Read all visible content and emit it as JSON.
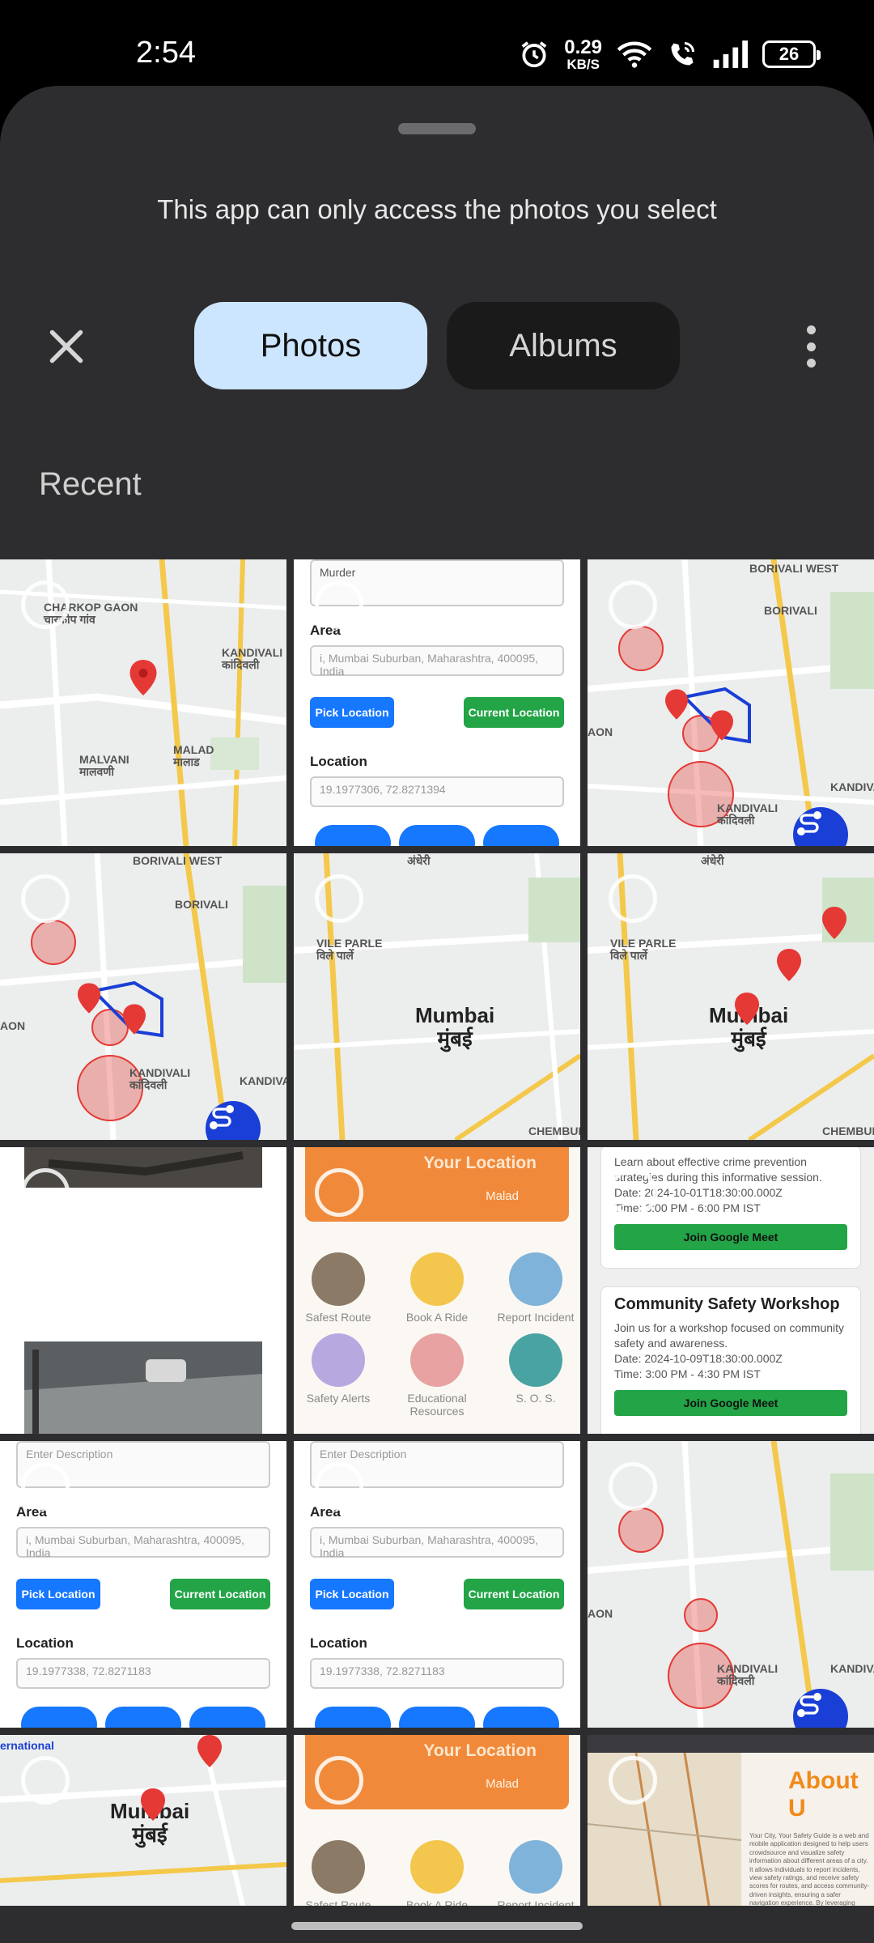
{
  "status_bar": {
    "time": "2:54",
    "speed_value": "0.29",
    "speed_unit": "KB/S",
    "battery": "26"
  },
  "sheet": {
    "notice": "This app can only access the photos you select",
    "tabs": [
      {
        "label": "Photos",
        "selected": true
      },
      {
        "label": "Albums",
        "selected": false
      }
    ],
    "section_title": "Recent"
  },
  "icons": {
    "close": "close-icon",
    "more": "more-vert-icon",
    "alarm": "alarm-icon",
    "wifi": "wifi-icon",
    "call": "wifi-call-icon",
    "signal": "signal-icon",
    "route": "route-icon"
  },
  "colors": {
    "sheet_bg": "#2d2d2f",
    "tab_selected": "#cde6ff",
    "tab_unselected": "#1a1a1b",
    "map_marker": "#e53935",
    "primary_blue": "#1677ff",
    "success_green": "#22a447",
    "location_orange": "#f08a3a"
  },
  "map_labels": {
    "charkop": "CHARKOP GAON",
    "charkop_hi": "चारकोप गांव",
    "kandivali": "KANDIVALI",
    "kandivali_hi": "कांदिवली",
    "malad": "MALAD",
    "malad_hi": "मालाड",
    "malvani": "MALVANI",
    "malvani_hi": "मालवणी",
    "borivali_west": "BORIVALI WEST",
    "borivali": "BORIVALI",
    "aon": "AON",
    "kandiva": "KANDIVA",
    "vile_parle": "VILE PARLE",
    "vile_parle_hi": "विले पार्ले",
    "andheri_hi": "अंधेरी",
    "chembur": "CHEMBUR",
    "mumbai": "Mumbai",
    "mumbai_hi": "मुंबई",
    "international": "ernational"
  },
  "form_screens": {
    "crime_type": "Murder",
    "description_placeholder": "Enter Description",
    "area_label": "Area",
    "area_value": "i, Mumbai Suburban, Maharashtra, 400095, India",
    "pick_location": "Pick Location",
    "current_location": "Current Location",
    "location_label": "Location",
    "coords_a": "19.1977306, 72.8271394",
    "coords_b": "19.1977338, 72.8271183"
  },
  "location_screen": {
    "title": "Your Location",
    "place": "Malad",
    "features": [
      "Safest Route",
      "Book A Ride",
      "Report Incident",
      "Safety Alerts",
      "Educational Resources",
      "S. O. S."
    ]
  },
  "events_screen": {
    "intro": "Learn about effective crime prevention strategies during this informative session.",
    "date1": "Date: 2024-10-01T18:30:00.000Z",
    "time1": "Time: 3:00 PM - 6:00 PM IST",
    "join_label": "Join Google Meet",
    "workshop_title": "Community Safety Workshop",
    "workshop_desc": "Join us for a workshop focused on community safety and awareness.",
    "date2": "Date: 2024-10-09T18:30:00.000Z",
    "time2": "Time: 3:00 PM - 4:30 PM IST"
  },
  "about_screen": {
    "title": "About U",
    "text": "Your City, Your Safety Guide is a web and mobile application designed to help users crowdsource and visualize safety information about different areas of a city. It allows individuals to report incidents, view safety ratings, and receive safety scores for routes, and access community-driven insights, ensuring a safer navigation experience. By leveraging user-generated data and visual tools, it empowers"
  }
}
